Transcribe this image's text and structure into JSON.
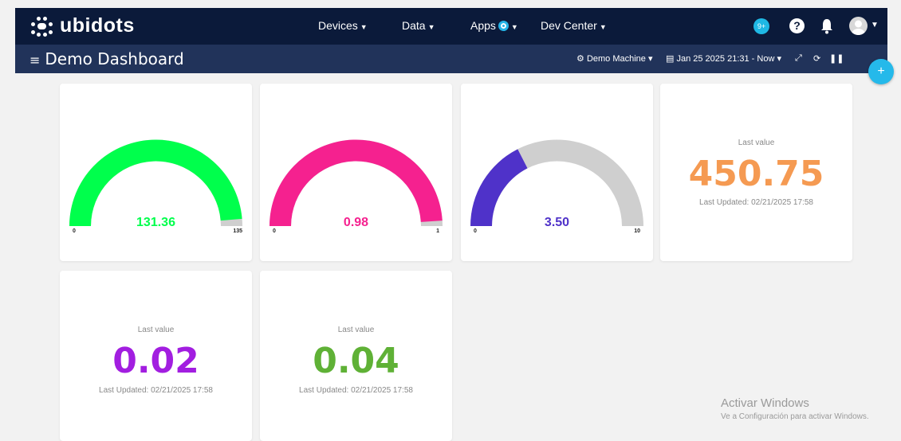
{
  "navbar": {
    "brand": "ubidots",
    "devices": "Devices",
    "data": "Data",
    "apps": "Apps",
    "dev_center": "Dev Center",
    "notif_badge": "9+",
    "help": "?"
  },
  "subbar": {
    "title": "Demo Dashboard",
    "device_selector": "Demo Machine",
    "date_range": "Jan 25 2025 21:31 - Now"
  },
  "fab": "+",
  "gauges": [
    {
      "value_text": "131.36",
      "value": 131.36,
      "min": "0",
      "max": "135",
      "color": "#00ff4c"
    },
    {
      "value_text": "0.98",
      "value": 0.98,
      "min": "0",
      "max": "1",
      "color": "#f5218f"
    },
    {
      "value_text": "3.50",
      "value": 3.5,
      "min": "0",
      "max": "10",
      "color": "#4f32c9"
    }
  ],
  "gauge_track_color": "#cfcfcf",
  "last_values": [
    {
      "label": "Last value",
      "value": "450.75",
      "updated": "Last Updated: 02/21/2025 17:58",
      "color": "#f59a52"
    },
    {
      "label": "Last value",
      "value": "0.02",
      "updated": "Last Updated: 02/21/2025 17:58",
      "color": "#a21ee0"
    },
    {
      "label": "Last value",
      "value": "0.04",
      "updated": "Last Updated: 02/21/2025 17:58",
      "color": "#5fb136"
    }
  ],
  "watermark": {
    "line1": "Activar Windows",
    "line2": "Ve a Configuración para activar Windows."
  }
}
